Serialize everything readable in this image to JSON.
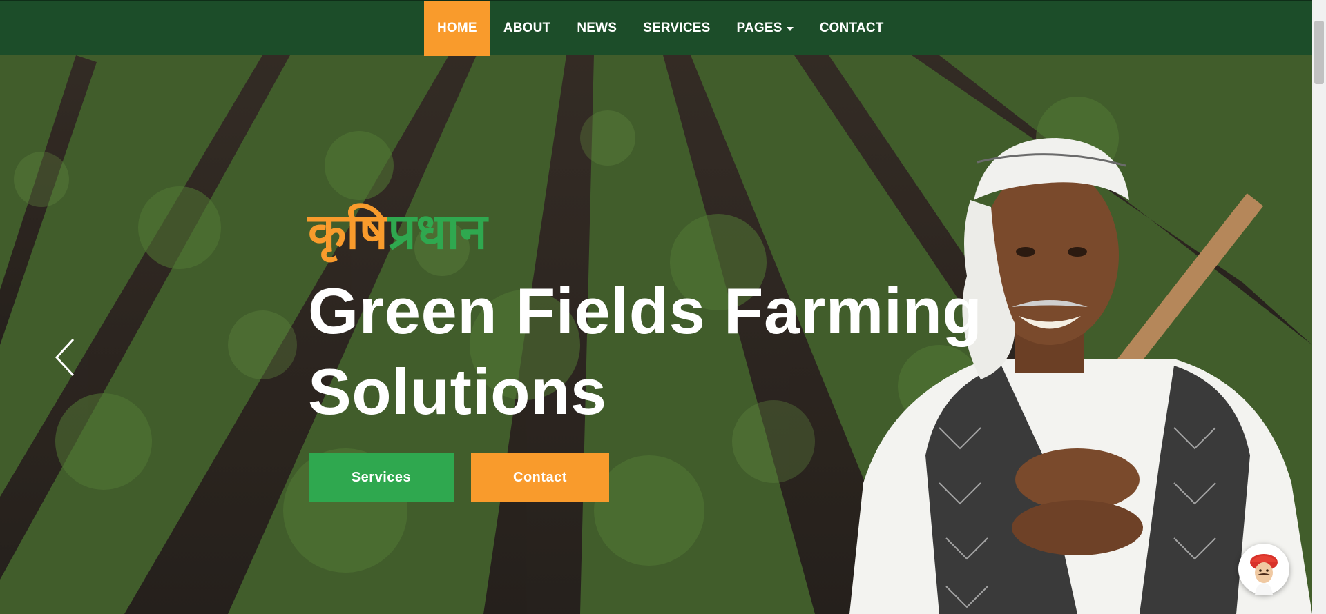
{
  "nav": {
    "items": [
      {
        "label": "HOME",
        "active": true
      },
      {
        "label": "ABOUT"
      },
      {
        "label": "NEWS"
      },
      {
        "label": "SERVICES"
      },
      {
        "label": "PAGES",
        "dropdown": true
      },
      {
        "label": "CONTACT"
      }
    ]
  },
  "hero": {
    "hindi_part1": "कृषि",
    "hindi_part2": "प्रधान",
    "heading": "Green Fields Farming Solutions",
    "services_button": "Services",
    "contact_button": "Contact",
    "prev_icon": "chevron-left-icon"
  },
  "chat_widget": {
    "icon": "farmer-avatar-icon"
  },
  "colors": {
    "nav_bg": "#1c4d29",
    "accent_orange": "#f99b2c",
    "accent_green": "#2fa84f"
  }
}
